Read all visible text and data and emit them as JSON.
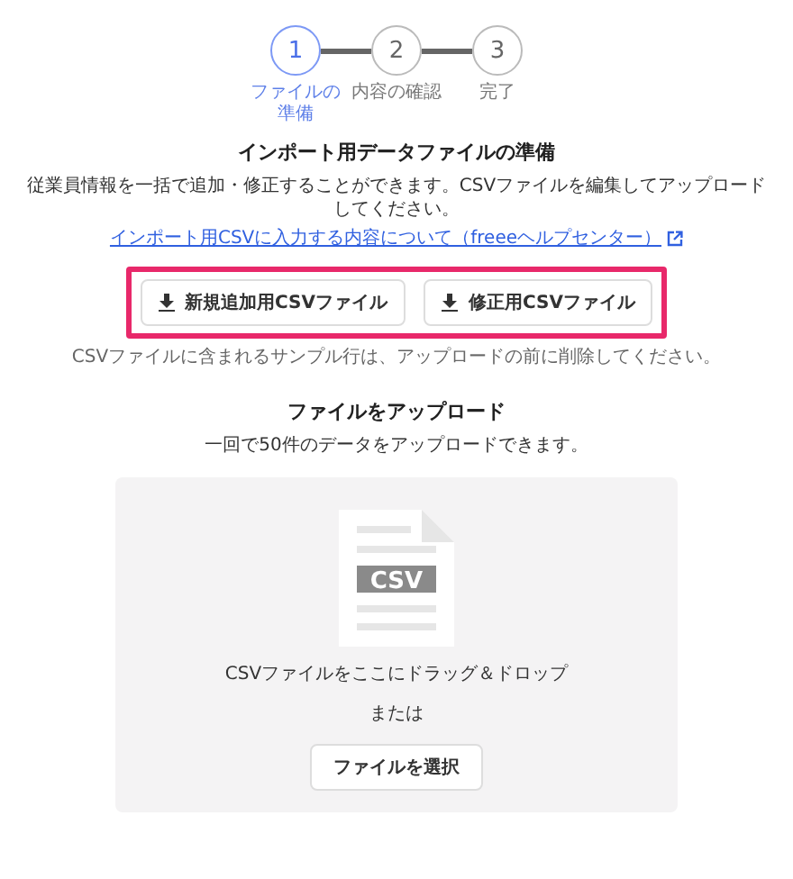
{
  "steps": [
    {
      "number": "1",
      "label": "ファイルの準備",
      "selected": true
    },
    {
      "number": "2",
      "label": "内容の確認",
      "selected": false
    },
    {
      "number": "3",
      "label": "完了",
      "selected": false
    }
  ],
  "prepare": {
    "title": "インポート用データファイルの準備",
    "description": "従業員情報を一括で追加・修正することができます。CSVファイルを編集してアップロードしてください。",
    "help_link": "インポート用CSVに入力する内容について（freeeヘルプセンター）",
    "buttons": [
      "新規追加用CSVファイル",
      "修正用CSVファイル"
    ],
    "note": "CSVファイルに含まれるサンプル行は、アップロードの前に削除してください。"
  },
  "upload": {
    "title": "ファイルをアップロード",
    "description": "一回で50件のデータをアップロードできます。",
    "file_icon_text": "CSV",
    "drop_text": "CSVファイルをここにドラッグ＆ドロップ",
    "or_text": "または",
    "select_button": "ファイルを選択"
  }
}
